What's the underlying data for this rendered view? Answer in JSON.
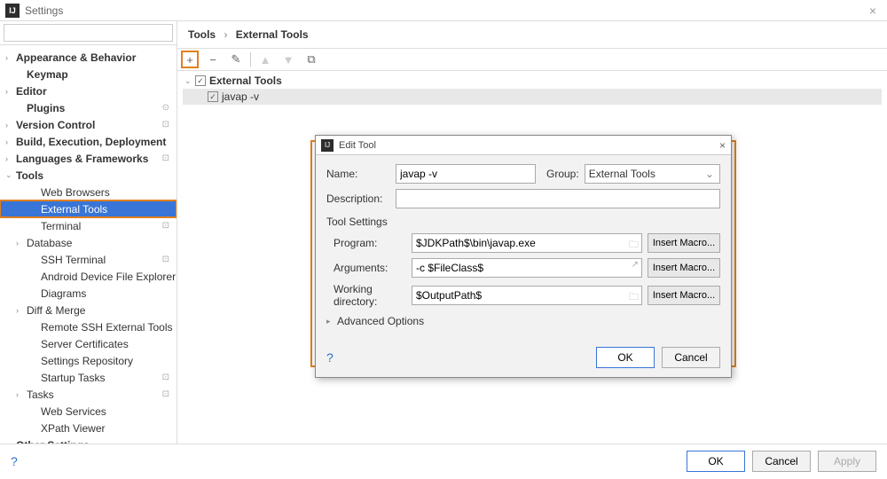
{
  "titlebar": {
    "title": "Settings"
  },
  "search": {
    "placeholder": ""
  },
  "sidebar": {
    "items": [
      {
        "label": "Appearance & Behavior",
        "arrow": "›",
        "bold": true,
        "level": 0
      },
      {
        "label": "Keymap",
        "arrow": "",
        "bold": true,
        "level": 1
      },
      {
        "label": "Editor",
        "arrow": "›",
        "bold": true,
        "level": 0
      },
      {
        "label": "Plugins",
        "arrow": "",
        "bold": true,
        "level": 1,
        "badge": "⊙"
      },
      {
        "label": "Version Control",
        "arrow": "›",
        "bold": true,
        "level": 0,
        "badge": "⊡"
      },
      {
        "label": "Build, Execution, Deployment",
        "arrow": "›",
        "bold": true,
        "level": 0
      },
      {
        "label": "Languages & Frameworks",
        "arrow": "›",
        "bold": true,
        "level": 0,
        "badge": "⊡"
      },
      {
        "label": "Tools",
        "arrow": "⌄",
        "bold": true,
        "level": 0
      },
      {
        "label": "Web Browsers",
        "arrow": "",
        "level": 2
      },
      {
        "label": "External Tools",
        "arrow": "",
        "level": 2,
        "selected": true
      },
      {
        "label": "Terminal",
        "arrow": "",
        "level": 2,
        "badge": "⊡"
      },
      {
        "label": "Database",
        "arrow": "›",
        "level": 1
      },
      {
        "label": "SSH Terminal",
        "arrow": "",
        "level": 2,
        "badge": "⊡"
      },
      {
        "label": "Android Device File Explorer",
        "arrow": "",
        "level": 2
      },
      {
        "label": "Diagrams",
        "arrow": "",
        "level": 2
      },
      {
        "label": "Diff & Merge",
        "arrow": "›",
        "level": 1
      },
      {
        "label": "Remote SSH External Tools",
        "arrow": "",
        "level": 2
      },
      {
        "label": "Server Certificates",
        "arrow": "",
        "level": 2
      },
      {
        "label": "Settings Repository",
        "arrow": "",
        "level": 2
      },
      {
        "label": "Startup Tasks",
        "arrow": "",
        "level": 2,
        "badge": "⊡"
      },
      {
        "label": "Tasks",
        "arrow": "›",
        "level": 1,
        "badge": "⊡"
      },
      {
        "label": "Web Services",
        "arrow": "",
        "level": 2
      },
      {
        "label": "XPath Viewer",
        "arrow": "",
        "level": 2
      },
      {
        "label": "Other Settings",
        "arrow": "›",
        "bold": true,
        "level": 0
      }
    ]
  },
  "breadcrumb": {
    "root": "Tools",
    "leaf": "External Tools"
  },
  "content_tree": {
    "group": "External Tools",
    "item": "javap -v"
  },
  "dialog": {
    "title": "Edit Tool",
    "name_label": "Name:",
    "name_value": "javap -v",
    "group_label": "Group:",
    "group_value": "External Tools",
    "desc_label": "Description:",
    "desc_value": "",
    "section": "Tool Settings",
    "program_label": "Program:",
    "program_value": "$JDKPath$\\bin\\javap.exe",
    "args_label": "Arguments:",
    "args_value": "-c $FileClass$",
    "workdir_label": "Working directory:",
    "workdir_value": "$OutputPath$",
    "macro_btn": "Insert Macro...",
    "advanced": "Advanced Options",
    "ok": "OK",
    "cancel": "Cancel"
  },
  "bottom": {
    "ok": "OK",
    "cancel": "Cancel",
    "apply": "Apply"
  }
}
